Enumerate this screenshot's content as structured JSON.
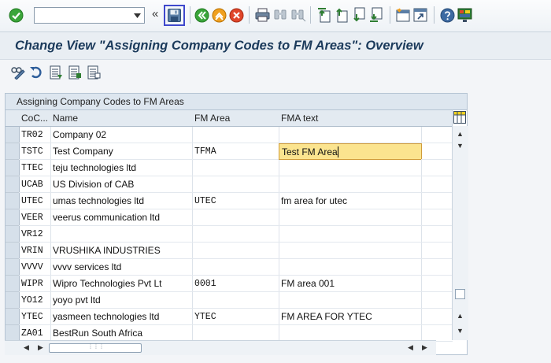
{
  "toolbar": {
    "command_field": {
      "value": "",
      "placeholder": ""
    },
    "icons": [
      "enter-icon",
      "command-dropdown-icon",
      "collapse-icon",
      "save-icon",
      "back-icon",
      "exit-icon",
      "cancel-icon",
      "print-icon",
      "find-icon",
      "find-next-icon",
      "first-page-icon",
      "previous-page-icon",
      "next-page-icon",
      "last-page-icon",
      "new-session-icon",
      "shortcut-icon",
      "help-icon",
      "customize-layout-icon"
    ],
    "collapse_glyph": "«"
  },
  "page_title": "Change View \"Assigning Company Codes to FM Areas\": Overview",
  "app_toolbar": {
    "icons": [
      "display-change-icon",
      "undo-icon",
      "select-all-icon",
      "select-block-icon",
      "deselect-all-icon"
    ]
  },
  "table": {
    "title": "Assigning Company Codes to FM Areas",
    "columns": [
      "CoC...",
      "Name",
      "FM Area",
      "FMA text"
    ],
    "rows": [
      {
        "coc": "TR02",
        "name": "Company 02",
        "fm_area": "",
        "fma_text": ""
      },
      {
        "coc": "TSTC",
        "name": "Test Company",
        "fm_area": "TFMA",
        "fma_text": "Test FM Area"
      },
      {
        "coc": "TTEC",
        "name": "teju technologies ltd",
        "fm_area": "",
        "fma_text": ""
      },
      {
        "coc": "UCAB",
        "name": "US Division of CAB",
        "fm_area": "",
        "fma_text": ""
      },
      {
        "coc": "UTEC",
        "name": "umas technologies ltd",
        "fm_area": "UTEC",
        "fma_text": "fm area for utec"
      },
      {
        "coc": "VEER",
        "name": "veerus communication ltd",
        "fm_area": "",
        "fma_text": ""
      },
      {
        "coc": "VR12",
        "name": "",
        "fm_area": "",
        "fma_text": ""
      },
      {
        "coc": "VRIN",
        "name": "VRUSHIKA INDUSTRIES",
        "fm_area": "",
        "fma_text": ""
      },
      {
        "coc": "VVVV",
        "name": "vvvv services ltd",
        "fm_area": "",
        "fma_text": ""
      },
      {
        "coc": "WIPR",
        "name": "Wipro Technologies Pvt Lt",
        "fm_area": "0001",
        "fma_text": "FM area 001"
      },
      {
        "coc": "YO12",
        "name": "yoyo pvt ltd",
        "fm_area": "",
        "fma_text": ""
      },
      {
        "coc": "YTEC",
        "name": "yasmeen technologies ltd",
        "fm_area": "YTEC",
        "fma_text": "FM AREA FOR YTEC"
      },
      {
        "coc": "ZA01",
        "name": "BestRun South Africa",
        "fm_area": "",
        "fma_text": ""
      }
    ],
    "active_cell": {
      "row": 1,
      "column": "fma_text"
    },
    "scrollbar_glyphs": {
      "up": "▲",
      "down": "▼",
      "left": "◀",
      "right": "▶",
      "grip": "⋮⋮⋮"
    }
  },
  "colors": {
    "title_text": "#1b3a5b",
    "active_cell_bg": "#fbe48f",
    "focus_border": "#3f48cc",
    "header_bg": "#e3eaf1"
  }
}
